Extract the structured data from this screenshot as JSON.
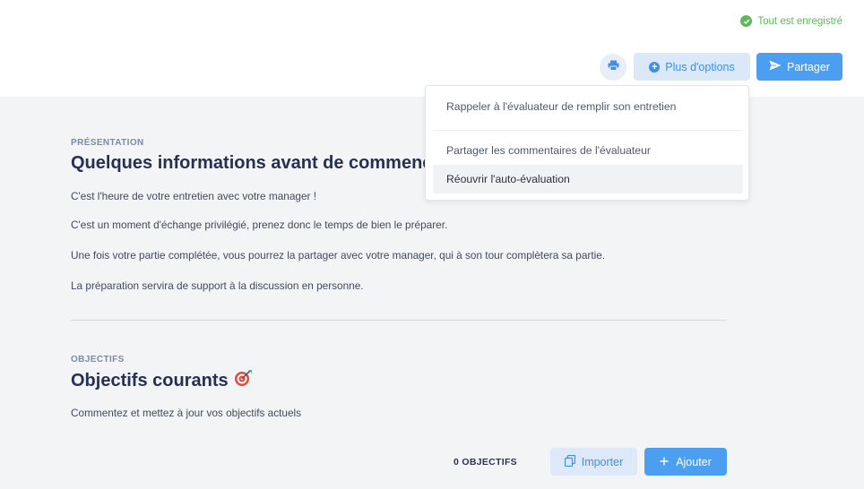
{
  "header": {
    "save_status": "Tout est enregistré",
    "more_options_label": "Plus d'options",
    "share_label": "Partager"
  },
  "dropdown": {
    "items": [
      {
        "label": "Rappeler à l'évaluateur de remplir son entretien"
      },
      {
        "label": "Partager les commentaires de l'évaluateur"
      },
      {
        "label": "Réouvrir l'auto-évaluation"
      }
    ]
  },
  "presentation": {
    "label": "PRÉSENTATION",
    "title": "Quelques informations avant de commencer",
    "paragraphs": [
      "C'est l'heure de votre entretien avec votre manager !",
      "C'est un moment d'échange privilégié, prenez donc le temps de bien le préparer.",
      "Une fois votre partie complétée, vous pourrez la partager avec votre manager, qui à son tour complètera sa partie.",
      "La préparation servira de support à la discussion en personne."
    ]
  },
  "objectives": {
    "label": "OBJECTIFS",
    "title": "Objectifs courants",
    "description": "Commentez et mettez à jour vos objectifs actuels",
    "count_label": "0 OBJECTIFS",
    "import_label": "Importer",
    "add_label": "Ajouter"
  },
  "colors": {
    "accent": "#4c9ff0",
    "success": "#5cb85c",
    "title": "#263052"
  }
}
